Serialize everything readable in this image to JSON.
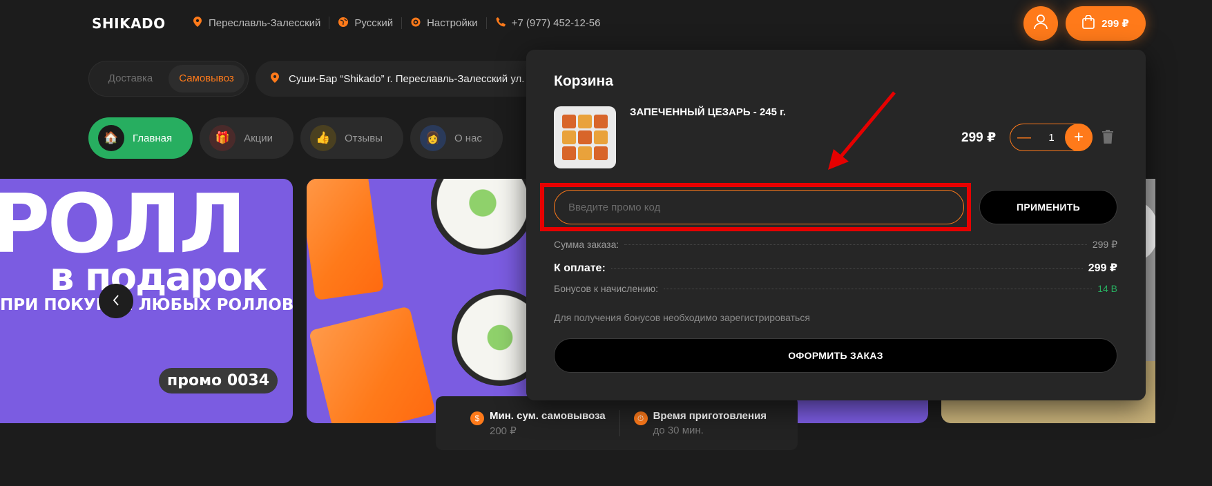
{
  "header": {
    "logo": "SHIKADO",
    "nav": [
      {
        "icon": "location-pin-icon",
        "label": "Переславль-Залесский"
      },
      {
        "icon": "globe-icon",
        "label": "Русский"
      },
      {
        "icon": "gear-icon",
        "label": "Настройки"
      },
      {
        "icon": "phone-icon",
        "label": "+7 (977) 452-12-56"
      }
    ],
    "cart_total": "299 ₽"
  },
  "delivery": {
    "options": [
      "Доставка",
      "Самовывоз"
    ],
    "selected": "Самовывоз",
    "address": "Суши-Бар “Shikado” г. Переславль-Залесский ул."
  },
  "categories": [
    {
      "label": "Главная",
      "icon": "home-icon",
      "active": true
    },
    {
      "label": "Акции",
      "icon": "gift-icon",
      "active": false
    },
    {
      "label": "Отзывы",
      "icon": "thumbs-up-icon",
      "active": false
    },
    {
      "label": "О нас",
      "icon": "person-icon",
      "active": false
    }
  ],
  "banner": {
    "line1": "РОЛЛ",
    "line2": "в подарок",
    "line3": "ПРИ ПОКУПКЕ ЛЮБЫХ РОЛЛОВ",
    "promo": "промо 0034"
  },
  "info": {
    "min_sum_label": "Мин. сум. самовывоза",
    "min_sum_value": "200 ₽",
    "prep_time_label": "Время приготовления",
    "prep_time_value": "до 30 мин."
  },
  "cart": {
    "title": "Корзина",
    "item_name": "ЗАПЕЧЕННЫЙ ЦЕЗАРЬ - 245 г.",
    "item_price": "299 ₽",
    "quantity": "1",
    "promo_placeholder": "Введите промо код",
    "apply_label": "ПРИМЕНИТЬ",
    "order_sum_label": "Сумма заказа:",
    "order_sum_value": "299 ₽",
    "to_pay_label": "К оплате:",
    "to_pay_value": "299 ₽",
    "bonus_label": "Бонусов к начислению:",
    "bonus_value": "14 B",
    "bonus_note": "Для получения бонусов необходимо зарегистрироваться",
    "checkout_label": "ОФОРМИТЬ ЗАКАЗ"
  },
  "colors": {
    "accent": "#ff7a1a",
    "active_green": "#27ae60",
    "banner_purple": "#7b5ce1",
    "annotation_red": "#e60000"
  }
}
